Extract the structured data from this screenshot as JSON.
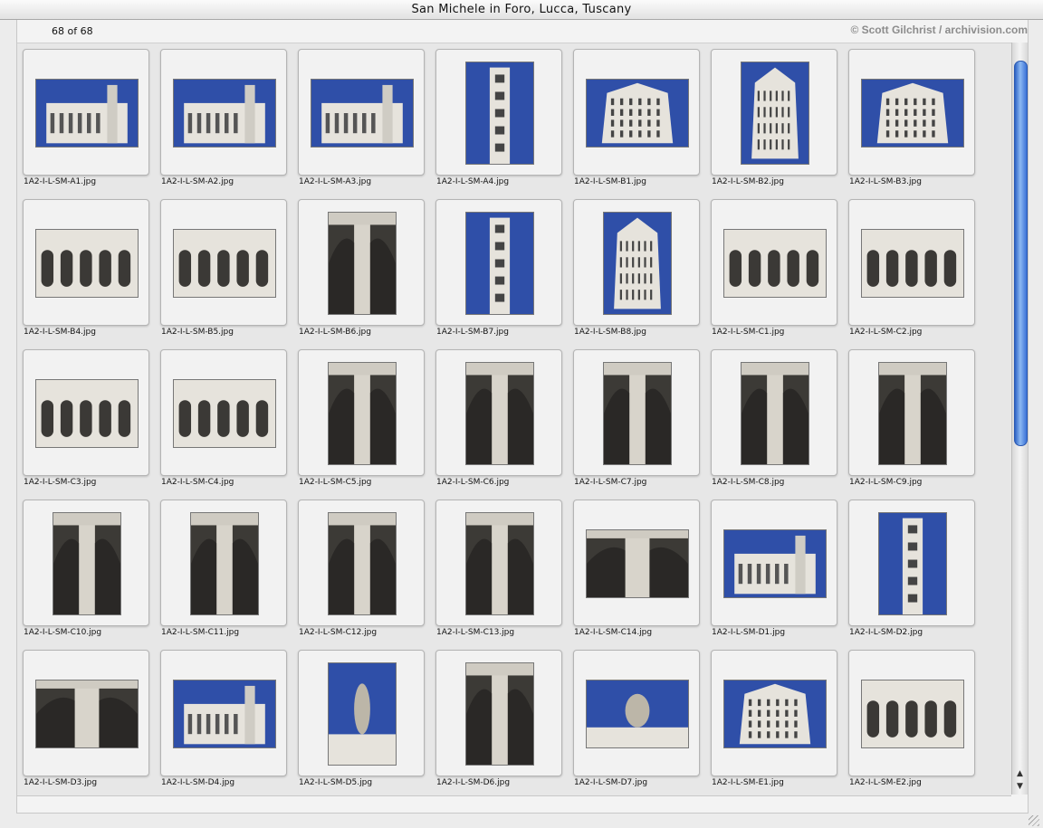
{
  "window": {
    "title": "San Michele in Foro, Lucca, Tuscany",
    "count": "68 of 68",
    "credit": "© Scott Gilchrist / archivision.com"
  },
  "colors": {
    "sky": "#2f4fa8",
    "stone_light": "#e6e3dc",
    "stone_dark": "#3c3a36",
    "frame_bg": "#f2f2f2",
    "scroll_accent": "#3a72d6"
  },
  "icons": {
    "scroll_up": "▲",
    "scroll_down": "▼"
  },
  "thumbnails": [
    {
      "filename": "1A2-I-L-SM-A1.jpg",
      "orientation": "landscape",
      "kind": "exterior"
    },
    {
      "filename": "1A2-I-L-SM-A2.jpg",
      "orientation": "landscape",
      "kind": "exterior"
    },
    {
      "filename": "1A2-I-L-SM-A3.jpg",
      "orientation": "landscape",
      "kind": "exterior"
    },
    {
      "filename": "1A2-I-L-SM-A4.jpg",
      "orientation": "portrait",
      "kind": "tower"
    },
    {
      "filename": "1A2-I-L-SM-B1.jpg",
      "orientation": "landscape",
      "kind": "facade"
    },
    {
      "filename": "1A2-I-L-SM-B2.jpg",
      "orientation": "portrait",
      "kind": "facade"
    },
    {
      "filename": "1A2-I-L-SM-B3.jpg",
      "orientation": "landscape",
      "kind": "facade"
    },
    {
      "filename": "1A2-I-L-SM-B4.jpg",
      "orientation": "landscape",
      "kind": "arcade"
    },
    {
      "filename": "1A2-I-L-SM-B5.jpg",
      "orientation": "landscape",
      "kind": "arcade"
    },
    {
      "filename": "1A2-I-L-SM-B6.jpg",
      "orientation": "portrait",
      "kind": "detail"
    },
    {
      "filename": "1A2-I-L-SM-B7.jpg",
      "orientation": "portrait",
      "kind": "tower"
    },
    {
      "filename": "1A2-I-L-SM-B8.jpg",
      "orientation": "portrait",
      "kind": "facade"
    },
    {
      "filename": "1A2-I-L-SM-C1.jpg",
      "orientation": "landscape",
      "kind": "arcade"
    },
    {
      "filename": "1A2-I-L-SM-C2.jpg",
      "orientation": "landscape",
      "kind": "arcade"
    },
    {
      "filename": "1A2-I-L-SM-C3.jpg",
      "orientation": "landscape",
      "kind": "arcade"
    },
    {
      "filename": "1A2-I-L-SM-C4.jpg",
      "orientation": "landscape",
      "kind": "arcade"
    },
    {
      "filename": "1A2-I-L-SM-C5.jpg",
      "orientation": "portrait",
      "kind": "detail"
    },
    {
      "filename": "1A2-I-L-SM-C6.jpg",
      "orientation": "portrait",
      "kind": "detail"
    },
    {
      "filename": "1A2-I-L-SM-C7.jpg",
      "orientation": "portrait",
      "kind": "detail"
    },
    {
      "filename": "1A2-I-L-SM-C8.jpg",
      "orientation": "portrait",
      "kind": "detail"
    },
    {
      "filename": "1A2-I-L-SM-C9.jpg",
      "orientation": "portrait",
      "kind": "detail"
    },
    {
      "filename": "1A2-I-L-SM-C10.jpg",
      "orientation": "portrait",
      "kind": "detail"
    },
    {
      "filename": "1A2-I-L-SM-C11.jpg",
      "orientation": "portrait",
      "kind": "detail"
    },
    {
      "filename": "1A2-I-L-SM-C12.jpg",
      "orientation": "portrait",
      "kind": "detail"
    },
    {
      "filename": "1A2-I-L-SM-C13.jpg",
      "orientation": "portrait",
      "kind": "detail"
    },
    {
      "filename": "1A2-I-L-SM-C14.jpg",
      "orientation": "landscape",
      "kind": "detail"
    },
    {
      "filename": "1A2-I-L-SM-D1.jpg",
      "orientation": "landscape",
      "kind": "exterior"
    },
    {
      "filename": "1A2-I-L-SM-D2.jpg",
      "orientation": "portrait",
      "kind": "tower"
    },
    {
      "filename": "1A2-I-L-SM-D3.jpg",
      "orientation": "landscape",
      "kind": "detail"
    },
    {
      "filename": "1A2-I-L-SM-D4.jpg",
      "orientation": "landscape",
      "kind": "exterior"
    },
    {
      "filename": "1A2-I-L-SM-D5.jpg",
      "orientation": "portrait",
      "kind": "statue"
    },
    {
      "filename": "1A2-I-L-SM-D6.jpg",
      "orientation": "portrait",
      "kind": "detail"
    },
    {
      "filename": "1A2-I-L-SM-D7.jpg",
      "orientation": "landscape",
      "kind": "statue"
    },
    {
      "filename": "1A2-I-L-SM-E1.jpg",
      "orientation": "landscape",
      "kind": "facade"
    },
    {
      "filename": "1A2-I-L-SM-E2.jpg",
      "orientation": "landscape",
      "kind": "arcade"
    }
  ]
}
